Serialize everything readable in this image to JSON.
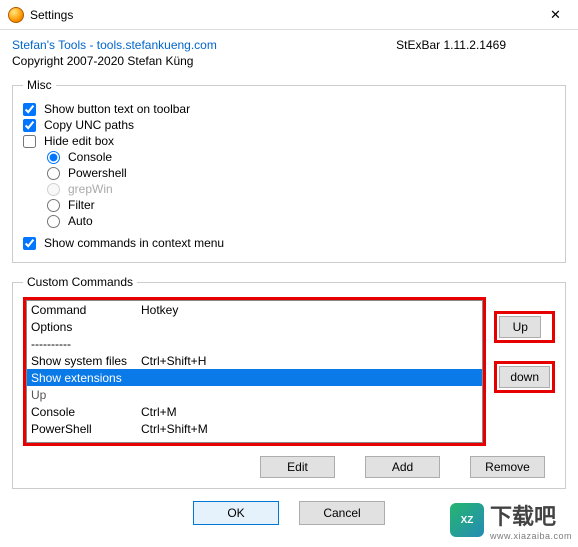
{
  "window": {
    "title": "Settings",
    "close_glyph": "✕"
  },
  "header": {
    "link_text": "Stefan's Tools - tools.stefankueng.com",
    "version": "StExBar 1.11.2.1469",
    "copyright": "Copyright 2007-2020 Stefan Küng"
  },
  "misc": {
    "legend": "Misc",
    "show_button_text": "Show button text on toolbar",
    "copy_unc": "Copy UNC paths",
    "hide_edit": "Hide edit box",
    "radios": {
      "console": "Console",
      "powershell": "Powershell",
      "grepwin": "grepWin",
      "filter": "Filter",
      "auto": "Auto"
    },
    "show_context": "Show commands in context menu"
  },
  "custom": {
    "legend": "Custom Commands",
    "headers": {
      "c1": "Command",
      "c2": "Hotkey"
    },
    "rows": [
      {
        "c1": "Options",
        "c2": ""
      },
      {
        "c1": "----------",
        "c2": ""
      },
      {
        "c1": "Show system files",
        "c2": "Ctrl+Shift+H"
      },
      {
        "c1": "Show extensions",
        "c2": "",
        "selected": true
      },
      {
        "c1": "Up",
        "c2": "",
        "dim": true
      },
      {
        "c1": "Console",
        "c2": "Ctrl+M"
      },
      {
        "c1": "PowerShell",
        "c2": "Ctrl+Shift+M"
      }
    ],
    "up": "Up",
    "down": "down",
    "edit": "Edit",
    "add": "Add",
    "remove": "Remove"
  },
  "dialog": {
    "ok": "OK",
    "cancel": "Cancel"
  },
  "watermark": {
    "text": "下载吧",
    "sub": "www.xiazaiba.com"
  }
}
